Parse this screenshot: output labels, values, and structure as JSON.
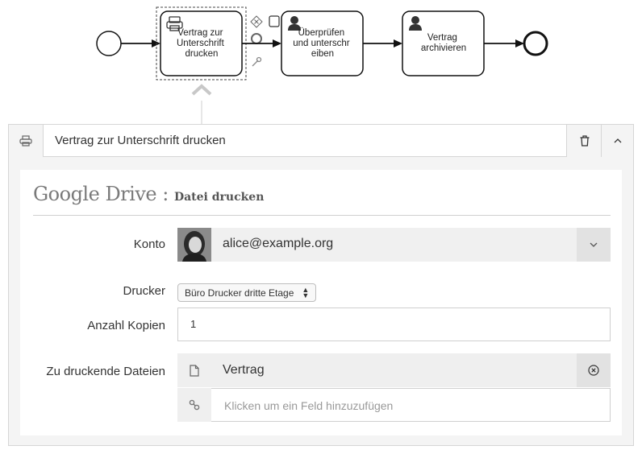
{
  "diagram": {
    "task1_lines": [
      "Vertrag zur",
      "Unterschrift",
      "drucken"
    ],
    "task2_lines": [
      "Überprüfen",
      "und unterschr",
      "eiben"
    ],
    "task3_lines": [
      "Vertrag",
      "archivieren"
    ]
  },
  "panel": {
    "header_title": "Vertrag zur Unterschrift drucken"
  },
  "card": {
    "title": "Google Drive :",
    "subtitle": "Datei drucken",
    "konto": {
      "label": "Konto",
      "value": "alice@example.org"
    },
    "drucker": {
      "label": "Drucker",
      "value": "Büro Drucker dritte Etage"
    },
    "kopien": {
      "label": "Anzahl Kopien",
      "value": "1"
    },
    "dateien": {
      "label": "Zu druckende Dateien",
      "file": "Vertrag",
      "placeholder": "Klicken um ein Feld hinzuzufügen"
    }
  }
}
